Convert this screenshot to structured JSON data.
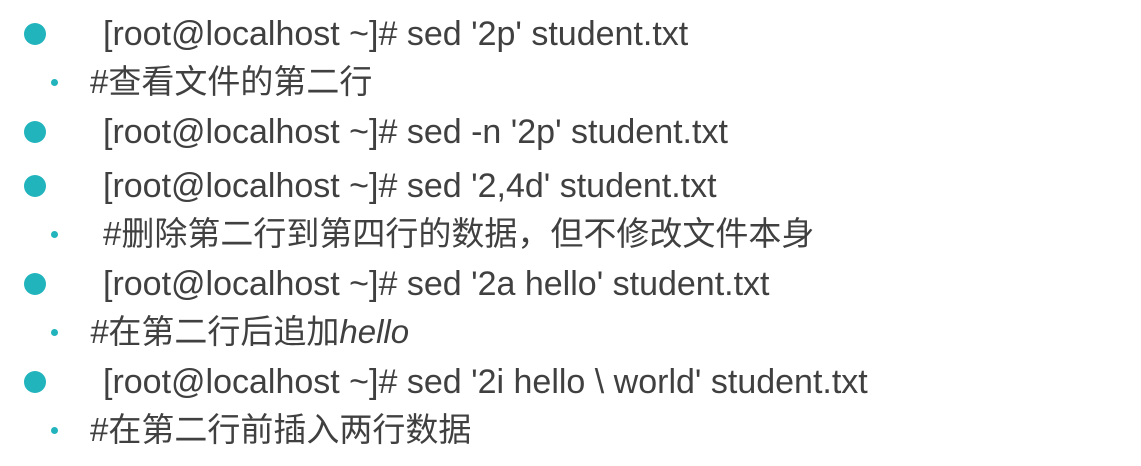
{
  "bullet_color": "#22b4bd",
  "text_color": "#404040",
  "items": [
    {
      "command": "[root@localhost ~]# sed '2p' student.txt",
      "comment": "#查看文件的第二行"
    },
    {
      "command": "[root@localhost ~]# sed -n '2p' student.txt"
    },
    {
      "command": "[root@localhost ~]# sed '2,4d' student.txt",
      "comment": "#删除第二行到第四行的数据，但不修改文件本身"
    },
    {
      "command": "[root@localhost ~]# sed '2a hello' student.txt",
      "comment_prefix": "#",
      "comment_mid": "在第二行后追加",
      "comment_suffix": "hello"
    },
    {
      "command": "[root@localhost ~]# sed '2i hello \\ world' student.txt",
      "comment": "#在第二行前插入两行数据"
    }
  ]
}
